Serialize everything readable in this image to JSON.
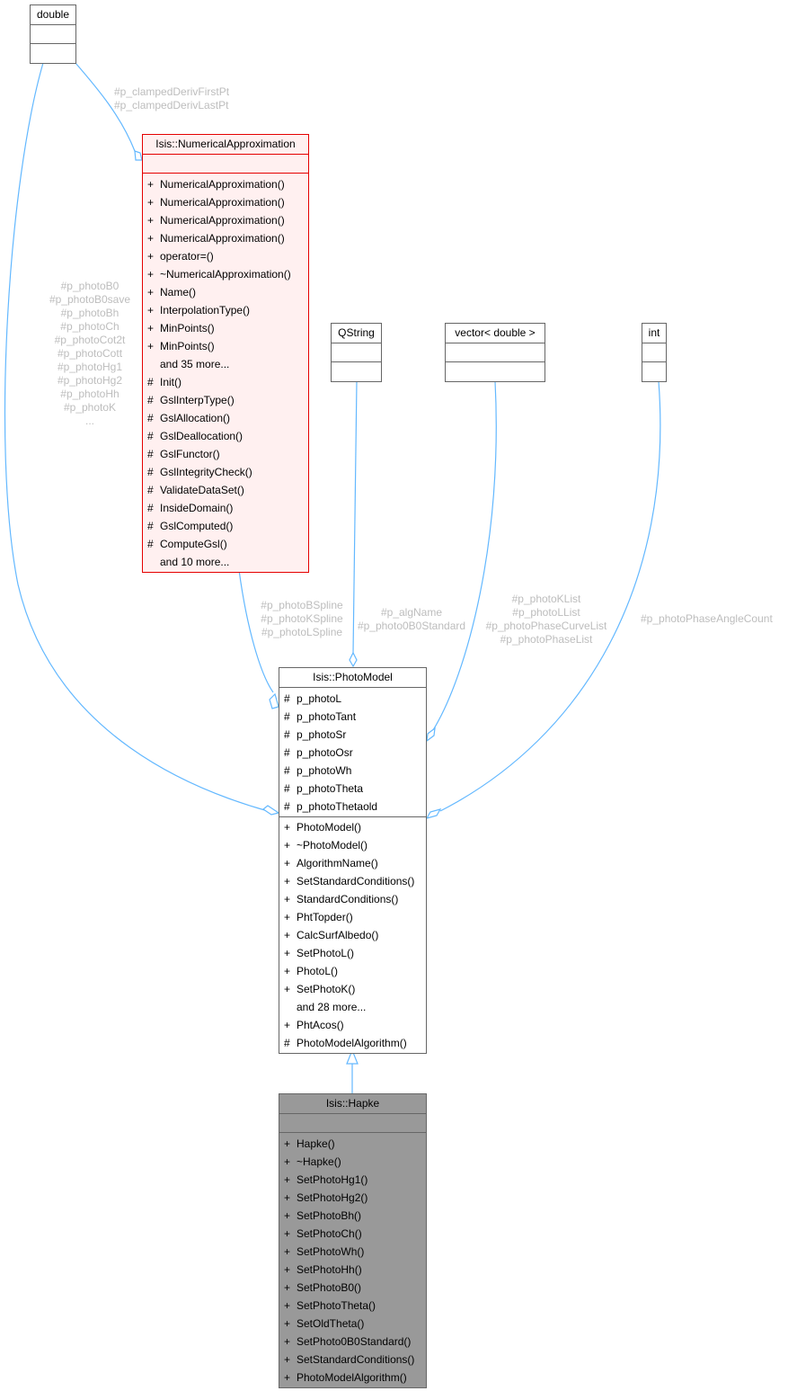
{
  "diagram": {
    "type": "UML collaboration diagram",
    "colors": {
      "edge": "#63b8ff",
      "label": "#bdbdbd",
      "focus_class_bg": "#999999",
      "numerical_border": "#e50000",
      "numerical_bg": "#fff0f0"
    }
  },
  "classes": {
    "double": {
      "name": "double"
    },
    "qstring": {
      "name": "QString"
    },
    "vector": {
      "name": "vector< double >"
    },
    "int": {
      "name": "int"
    },
    "numerical": {
      "name": "Isis::NumericalApproximation",
      "public": [
        "NumericalApproximation()",
        "NumericalApproximation()",
        "NumericalApproximation()",
        "NumericalApproximation()",
        "operator=()",
        "~NumericalApproximation()",
        "Name()",
        "InterpolationType()",
        "MinPoints()",
        "MinPoints()"
      ],
      "public_more": "and 35 more...",
      "protected": [
        "Init()",
        "GslInterpType()",
        "GslAllocation()",
        "GslDeallocation()",
        "GslFunctor()",
        "GslIntegrityCheck()",
        "ValidateDataSet()",
        "InsideDomain()",
        "GslComputed()",
        "ComputeGsl()"
      ],
      "protected_more": "and 10 more..."
    },
    "photomodel": {
      "name": "Isis::PhotoModel",
      "attributes": [
        "p_photoL",
        "p_photoTant",
        "p_photoSr",
        "p_photoOsr",
        "p_photoWh",
        "p_photoTheta",
        "p_photoThetaold"
      ],
      "public": [
        "PhotoModel()",
        "~PhotoModel()",
        "AlgorithmName()",
        "SetStandardConditions()",
        "StandardConditions()",
        "PhtTopder()",
        "CalcSurfAlbedo()",
        "SetPhotoL()",
        "PhotoL()",
        "SetPhotoK()"
      ],
      "public_more": "and 28 more...",
      "static_public": [
        "PhtAcos()"
      ],
      "protected": [
        "PhotoModelAlgorithm()"
      ]
    },
    "hapke": {
      "name": "Isis::Hapke",
      "public": [
        "Hapke()",
        "~Hapke()",
        "SetPhotoHg1()",
        "SetPhotoHg2()",
        "SetPhotoBh()",
        "SetPhotoCh()",
        "SetPhotoWh()",
        "SetPhotoHh()",
        "SetPhotoB0()",
        "SetPhotoTheta()",
        "SetOldTheta()",
        "SetPhoto0B0Standard()",
        "SetStandardConditions()",
        "PhotoModelAlgorithm()"
      ]
    }
  },
  "edge_labels": {
    "double_to_numerical": [
      "#p_clampedDerivFirstPt",
      "#p_clampedDerivLastPt"
    ],
    "double_to_photomodel": [
      "#p_photoB0",
      "#p_photoB0save",
      "#p_photoBh",
      "#p_photoCh",
      "#p_photoCot2t",
      "#p_photoCott",
      "#p_photoHg1",
      "#p_photoHg2",
      "#p_photoHh",
      "#p_photoK",
      "..."
    ],
    "numerical_to_photomodel": [
      "#p_photoBSpline",
      "#p_photoKSpline",
      "#p_photoLSpline"
    ],
    "qstring_to_photomodel": [
      "#p_algName",
      "#p_photo0B0Standard"
    ],
    "vector_to_photomodel": [
      "#p_photoKList",
      "#p_photoLList",
      "#p_photoPhaseCurveList",
      "#p_photoPhaseList"
    ],
    "int_to_photomodel": [
      "#p_photoPhaseAngleCount"
    ]
  },
  "symbols": {
    "public": "+",
    "protected": "#"
  }
}
